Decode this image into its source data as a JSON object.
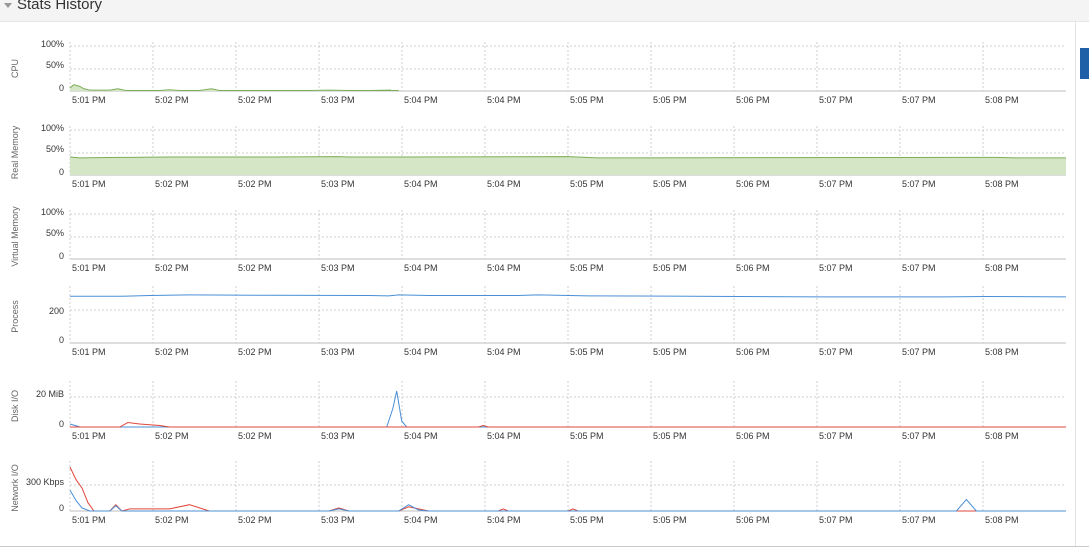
{
  "panel": {
    "title": "Stats History"
  },
  "time_labels": [
    "5:01 PM",
    "5:02 PM",
    "5:02 PM",
    "5:03 PM",
    "5:04 PM",
    "5:04 PM",
    "5:05 PM",
    "5:05 PM",
    "5:06 PM",
    "5:07 PM",
    "5:07 PM",
    "5:08 PM"
  ],
  "colors": {
    "green_line": "#7cae58",
    "green_fill": "#d4e6c6",
    "blue": "#4a8fd6",
    "red": "#e0473a",
    "grid": "#cfcfcf"
  },
  "chart_data": [
    {
      "type": "area",
      "title": "",
      "ylabel": "CPU",
      "y_ticks": [
        "100%",
        "50%",
        "0"
      ],
      "ylim": [
        0,
        100
      ],
      "x_tick_labels": [
        "5:01 PM",
        "5:02 PM",
        "5:02 PM",
        "5:03 PM",
        "5:04 PM",
        "5:04 PM",
        "5:05 PM",
        "5:05 PM",
        "5:06 PM",
        "5:07 PM",
        "5:07 PM",
        "5:08 PM"
      ],
      "series": [
        {
          "color": "#7cae58",
          "fill": "#d4e6c6",
          "points": [
            [
              0,
              7
            ],
            [
              0.004,
              14
            ],
            [
              0.01,
              10
            ],
            [
              0.014,
              5
            ],
            [
              0.02,
              2
            ],
            [
              0.04,
              2
            ],
            [
              0.048,
              5
            ],
            [
              0.056,
              1
            ],
            [
              0.09,
              1
            ],
            [
              0.1,
              3
            ],
            [
              0.11,
              1
            ],
            [
              0.13,
              1
            ],
            [
              0.142,
              5
            ],
            [
              0.15,
              1
            ],
            [
              0.2,
              1
            ],
            [
              0.24,
              1
            ],
            [
              0.26,
              2
            ],
            [
              0.28,
              1
            ],
            [
              0.3,
              1
            ],
            [
              0.32,
              1
            ],
            [
              0.33,
              1
            ],
            [
              0.316,
              1
            ],
            [
              0.322,
              2
            ],
            [
              0.3,
              1
            ],
            [
              0.3,
              1
            ]
          ]
        }
      ]
    },
    {
      "type": "area",
      "title": "",
      "ylabel": "Real Memory",
      "y_ticks": [
        "100%",
        "50%",
        "0"
      ],
      "ylim": [
        0,
        100
      ],
      "x_tick_labels": [
        "5:01 PM",
        "5:02 PM",
        "5:02 PM",
        "5:03 PM",
        "5:04 PM",
        "5:04 PM",
        "5:05 PM",
        "5:05 PM",
        "5:06 PM",
        "5:07 PM",
        "5:07 PM",
        "5:08 PM"
      ],
      "series": [
        {
          "color": "#7cae58",
          "fill": "#d4e6c6",
          "points": [
            [
              0,
              40
            ],
            [
              0.01,
              38
            ],
            [
              0.05,
              39
            ],
            [
              0.1,
              40
            ],
            [
              0.2,
              40
            ],
            [
              0.27,
              41
            ],
            [
              0.28,
              40
            ],
            [
              0.33,
              40
            ],
            [
              0.5,
              41
            ],
            [
              0.53,
              38
            ],
            [
              0.9,
              39
            ],
            [
              0.93,
              39
            ],
            [
              0.95,
              38
            ],
            [
              1,
              38
            ]
          ]
        }
      ]
    },
    {
      "type": "area",
      "title": "",
      "ylabel": "Virtual Memory",
      "y_ticks": [
        "100%",
        "50%",
        "0"
      ],
      "ylim": [
        0,
        100
      ],
      "x_tick_labels": [
        "5:01 PM",
        "5:02 PM",
        "5:02 PM",
        "5:03 PM",
        "5:04 PM",
        "5:04 PM",
        "5:05 PM",
        "5:05 PM",
        "5:06 PM",
        "5:07 PM",
        "5:07 PM",
        "5:08 PM"
      ],
      "series": []
    },
    {
      "type": "line",
      "title": "",
      "ylabel": "Process",
      "y_ticks": [
        "200",
        "0"
      ],
      "ylim": [
        0,
        260
      ],
      "x_tick_labels": [
        "5:01 PM",
        "5:02 PM",
        "5:02 PM",
        "5:03 PM",
        "5:04 PM",
        "5:04 PM",
        "5:05 PM",
        "5:05 PM",
        "5:06 PM",
        "5:07 PM",
        "5:07 PM",
        "5:08 PM"
      ],
      "series": [
        {
          "color": "#4a8fd6",
          "points": [
            [
              0,
              229
            ],
            [
              0.05,
              229
            ],
            [
              0.08,
              233
            ],
            [
              0.12,
              236
            ],
            [
              0.2,
              234
            ],
            [
              0.3,
              233
            ],
            [
              0.32,
              231
            ],
            [
              0.33,
              236
            ],
            [
              0.36,
              233
            ],
            [
              0.45,
              233
            ],
            [
              0.47,
              236
            ],
            [
              0.52,
              231
            ],
            [
              0.6,
              230
            ],
            [
              0.75,
              226
            ],
            [
              0.88,
              226
            ],
            [
              0.92,
              228
            ],
            [
              1,
              226
            ]
          ]
        }
      ]
    },
    {
      "type": "line",
      "title": "",
      "ylabel": "Disk I/O",
      "y_ticks": [
        "20 MiB",
        "0"
      ],
      "ylim": [
        0,
        28
      ],
      "x_tick_labels": [
        "5:01 PM",
        "5:02 PM",
        "5:02 PM",
        "5:03 PM",
        "5:04 PM",
        "5:04 PM",
        "5:05 PM",
        "5:05 PM",
        "5:06 PM",
        "5:07 PM",
        "5:07 PM",
        "5:08 PM"
      ],
      "series": [
        {
          "color": "#4a8fd6",
          "points": [
            [
              0,
              2
            ],
            [
              0.01,
              0
            ],
            [
              0.318,
              0
            ],
            [
              0.324,
              12
            ],
            [
              0.328,
              24
            ],
            [
              0.333,
              4
            ],
            [
              0.338,
              0
            ],
            [
              1,
              0
            ]
          ]
        },
        {
          "color": "#e0473a",
          "points": [
            [
              0,
              0
            ],
            [
              0.05,
              0
            ],
            [
              0.058,
              3
            ],
            [
              0.07,
              2
            ],
            [
              0.09,
              1
            ],
            [
              0.1,
              0
            ],
            [
              0.41,
              0
            ],
            [
              0.415,
              1
            ],
            [
              0.42,
              0
            ],
            [
              1,
              0
            ]
          ]
        }
      ]
    },
    {
      "type": "line",
      "title": "",
      "ylabel": "Network I/O",
      "y_ticks": [
        "300 Kbps",
        "0"
      ],
      "ylim": [
        0,
        440
      ],
      "x_tick_labels": [
        "5:01 PM",
        "5:02 PM",
        "5:02 PM",
        "5:03 PM",
        "5:04 PM",
        "5:04 PM",
        "5:05 PM",
        "5:05 PM",
        "5:06 PM",
        "5:07 PM",
        "5:07 PM",
        "5:08 PM"
      ],
      "series": [
        {
          "color": "#e0473a",
          "points": [
            [
              0,
              420
            ],
            [
              0.006,
              300
            ],
            [
              0.012,
              220
            ],
            [
              0.018,
              80
            ],
            [
              0.024,
              0
            ],
            [
              0.04,
              0
            ],
            [
              0.046,
              60
            ],
            [
              0.052,
              0
            ],
            [
              0.06,
              20
            ],
            [
              0.1,
              20
            ],
            [
              0.12,
              60
            ],
            [
              0.13,
              30
            ],
            [
              0.14,
              0
            ],
            [
              0.26,
              0
            ],
            [
              0.27,
              30
            ],
            [
              0.28,
              0
            ],
            [
              0.33,
              0
            ],
            [
              0.34,
              40
            ],
            [
              0.35,
              20
            ],
            [
              0.36,
              0
            ],
            [
              0.43,
              0
            ],
            [
              0.435,
              20
            ],
            [
              0.44,
              0
            ],
            [
              0.5,
              0
            ],
            [
              0.505,
              20
            ],
            [
              0.51,
              0
            ],
            [
              1,
              0
            ]
          ]
        },
        {
          "color": "#4a8fd6",
          "points": [
            [
              0,
              200
            ],
            [
              0.006,
              100
            ],
            [
              0.012,
              30
            ],
            [
              0.02,
              0
            ],
            [
              0.04,
              0
            ],
            [
              0.046,
              50
            ],
            [
              0.052,
              0
            ],
            [
              0.26,
              0
            ],
            [
              0.27,
              20
            ],
            [
              0.28,
              0
            ],
            [
              0.33,
              0
            ],
            [
              0.34,
              60
            ],
            [
              0.35,
              10
            ],
            [
              0.36,
              0
            ],
            [
              0.89,
              0
            ],
            [
              0.9,
              110
            ],
            [
              0.91,
              0
            ],
            [
              1,
              0
            ]
          ]
        }
      ]
    }
  ]
}
